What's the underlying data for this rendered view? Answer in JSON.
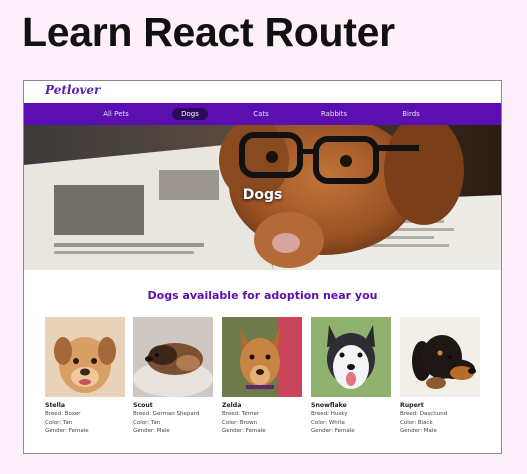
{
  "slide": {
    "title": "Learn React Router"
  },
  "site": {
    "brand": "Petlover",
    "nav": [
      "All Pets",
      "Dogs",
      "Cats",
      "Rabbits",
      "Birds"
    ],
    "active_nav": "Dogs",
    "hero_title": "Dogs",
    "section_heading": "Dogs available for adoption near you"
  },
  "pets": [
    {
      "name": "Stella",
      "breed": "Breed: Boxer",
      "color": "Color: Tan",
      "gender": "Gender: Female"
    },
    {
      "name": "Scout",
      "breed": "Breed: German Shepard",
      "color": "Color: Tan",
      "gender": "Gender: Male"
    },
    {
      "name": "Zelda",
      "breed": "Breed: Terrier",
      "color": "Color: Brown",
      "gender": "Gender: Female"
    },
    {
      "name": "Snowflake",
      "breed": "Breed: Husky",
      "color": "Color: White",
      "gender": "Gender: Female"
    },
    {
      "name": "Rupert",
      "breed": "Breed: Daschund",
      "color": "Color: Black",
      "gender": "Gender: Male"
    }
  ],
  "colors": {
    "brand": "#5b0fb0",
    "nav_active": "#2c0a5c",
    "slide_bg": "#fdf0fa"
  }
}
